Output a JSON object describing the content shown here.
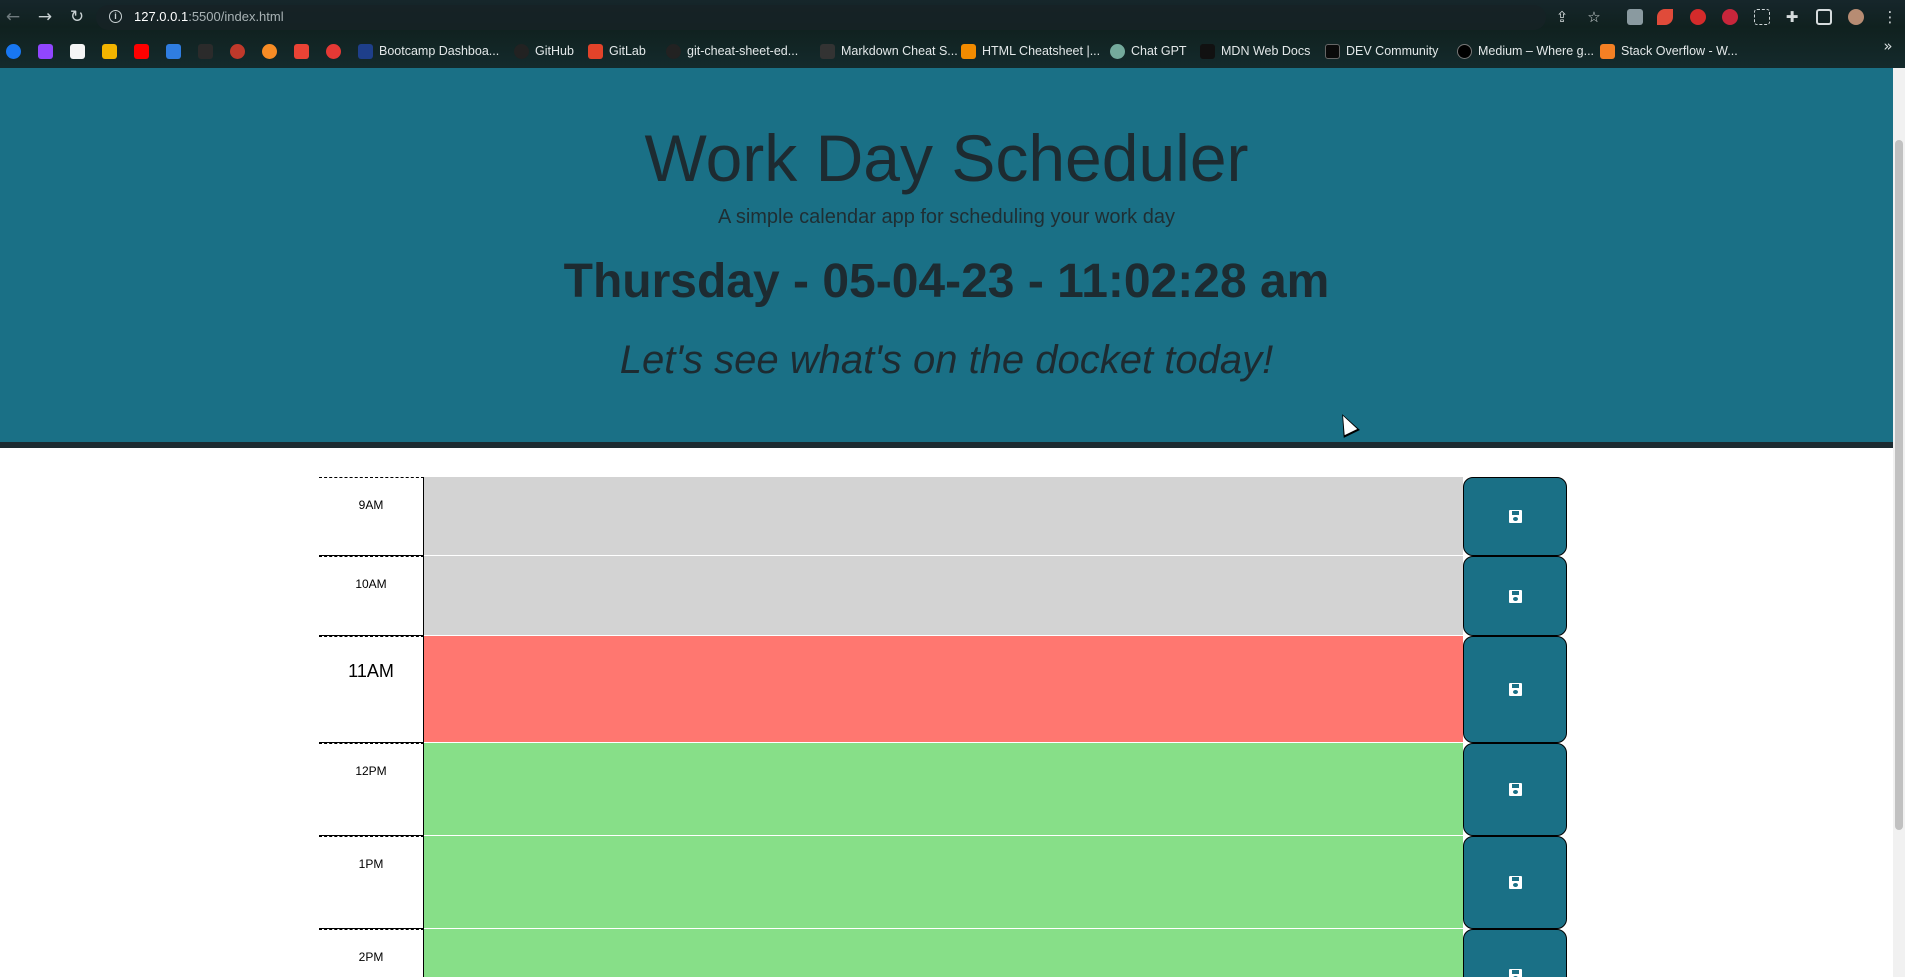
{
  "browser": {
    "url_host": "127.0.0.1",
    "url_path": ":5500/index.html",
    "bookmarks": [
      {
        "label": "Bootcamp Dashboa...",
        "icon": "uci-icon",
        "color": "#1e3f8a"
      },
      {
        "label": "GitHub",
        "icon": "github-icon",
        "color": "#222222"
      },
      {
        "label": "GitLab",
        "icon": "gitlab-icon",
        "color": "#e2432a"
      },
      {
        "label": "git-cheat-sheet-ed...",
        "icon": "github-icon",
        "color": "#222222"
      },
      {
        "label": "Markdown Cheat S...",
        "icon": "markdown-icon",
        "color": "#333333"
      },
      {
        "label": "HTML Cheatsheet |...",
        "icon": "html-icon",
        "color": "#f28b00"
      },
      {
        "label": "Chat GPT",
        "icon": "chatgpt-icon",
        "color": "#74aa9c"
      },
      {
        "label": "MDN Web Docs",
        "icon": "mdn-icon",
        "color": "#111111"
      },
      {
        "label": "DEV Community",
        "icon": "dev-icon",
        "color": "#0a0a0a"
      },
      {
        "label": "Medium – Where g...",
        "icon": "medium-icon",
        "color": "#000000"
      },
      {
        "label": "Stack Overflow - W...",
        "icon": "stackoverflow-icon",
        "color": "#f48024"
      }
    ]
  },
  "header": {
    "title": "Work Day Scheduler",
    "lead": "A simple calendar app for scheduling your work day",
    "current_day": "Thursday - 05-04-23 - 11:02:28 am",
    "tagline": "Let's see what's on the docket today!"
  },
  "schedule": {
    "rows": [
      {
        "hour": "9AM",
        "state": "past",
        "text": ""
      },
      {
        "hour": "10AM",
        "state": "past",
        "text": ""
      },
      {
        "hour": "11AM",
        "state": "present",
        "text": ""
      },
      {
        "hour": "12PM",
        "state": "future",
        "text": ""
      },
      {
        "hour": "1PM",
        "state": "future",
        "text": ""
      },
      {
        "hour": "2PM",
        "state": "future",
        "text": ""
      }
    ]
  },
  "colors": {
    "jumbotron": "#1a7086",
    "past": "#d3d3d3",
    "present": "#ff7770",
    "future": "#87df88",
    "save_button": "#1a7086"
  }
}
